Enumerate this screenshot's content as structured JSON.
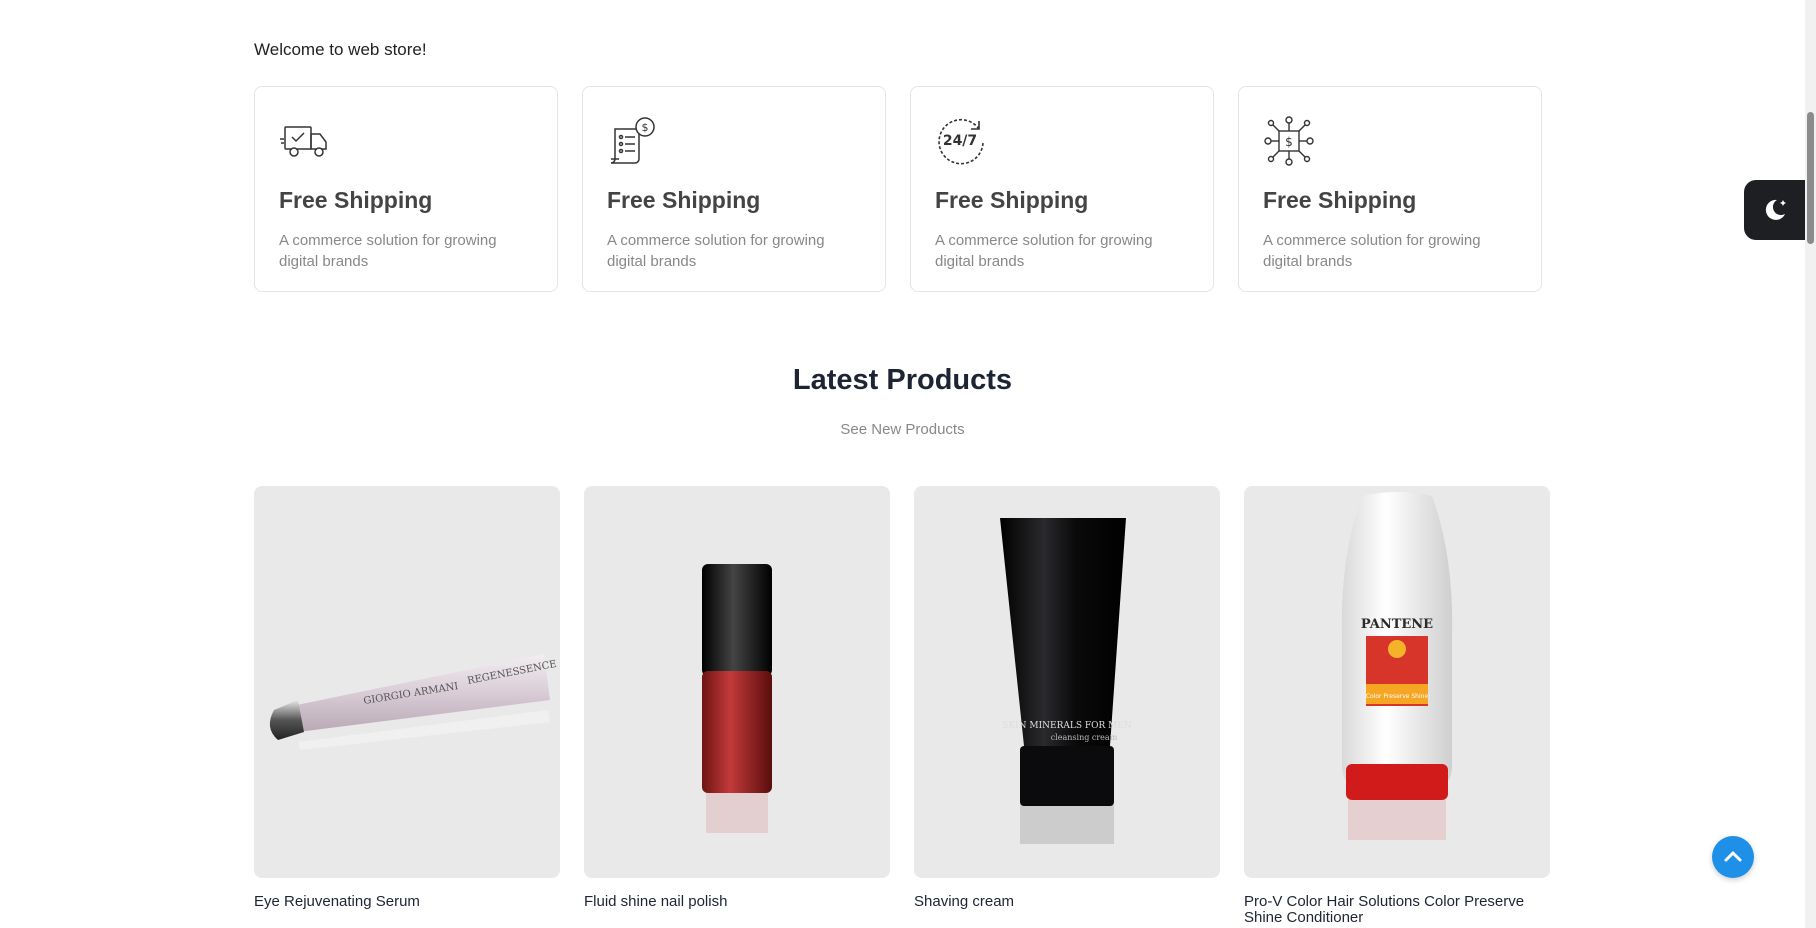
{
  "welcome_text": "Welcome to web store!",
  "features": [
    {
      "icon": "delivery-truck-icon",
      "title": "Free Shipping",
      "description": "A commerce solution for growing digital brands"
    },
    {
      "icon": "receipt-dollar-icon",
      "title": "Free Shipping",
      "description": "A commerce solution for growing digital brands"
    },
    {
      "icon": "support-24-7-icon",
      "title": "Free Shipping",
      "description": "A commerce solution for growing digital brands"
    },
    {
      "icon": "money-network-icon",
      "title": "Free Shipping",
      "description": "A commerce solution for growing digital brands"
    }
  ],
  "latest": {
    "title": "Latest Products",
    "subtitle": "See New Products"
  },
  "products": [
    {
      "name": "Eye Rejuvenating Serum",
      "image_icon": "serum-tube-image"
    },
    {
      "name": "Fluid shine nail polish",
      "image_icon": "nail-polish-image"
    },
    {
      "name": "Shaving cream",
      "image_icon": "cream-tube-image"
    },
    {
      "name": "Pro-V Color Hair Solutions Color Preserve Shine Conditioner",
      "image_icon": "conditioner-bottle-image"
    }
  ],
  "product_image_text": {
    "serum_brand": "GIORGIO ARMANI",
    "serum_line": "REGENESSENCE",
    "cream_label": "SKIN MINERALS FOR MEN",
    "cream_sub": "cleansing cream",
    "conditioner_brand": "PANTENE",
    "conditioner_line": "Color Preserve Shine"
  },
  "colors": {
    "accent_blue": "#1e90e8",
    "toggle_bg": "#1e1f22",
    "card_border": "#e4e4e4",
    "product_bg": "#e9e9ea"
  }
}
